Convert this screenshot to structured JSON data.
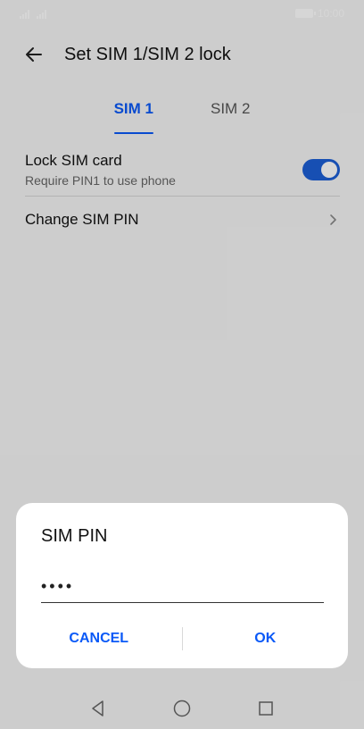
{
  "status_bar": {
    "time": "10:00",
    "signal_icons": [
      "signal-1-icon",
      "signal-2-icon"
    ],
    "battery_icon": "battery-icon"
  },
  "app_bar": {
    "title": "Set SIM 1/SIM 2 lock",
    "back_icon": "back-arrow-icon"
  },
  "tabs": [
    {
      "label": "SIM 1",
      "active": true
    },
    {
      "label": "SIM 2",
      "active": false
    }
  ],
  "settings": {
    "lock_sim": {
      "title": "Lock SIM card",
      "subtitle": "Require PIN1 to use phone",
      "enabled": true
    },
    "change_pin": {
      "title": "Change SIM PIN"
    }
  },
  "dialog": {
    "title": "SIM PIN",
    "pin_value": "••••",
    "cancel_label": "CANCEL",
    "ok_label": "OK"
  },
  "nav_bar": {
    "icons": [
      "nav-back-icon",
      "nav-home-icon",
      "nav-recents-icon"
    ]
  },
  "colors": {
    "accent": "#0a59f7",
    "toggle_on": "#1c5fd6",
    "background": "#f5f5f5",
    "dialog_bg": "#ffffff"
  }
}
